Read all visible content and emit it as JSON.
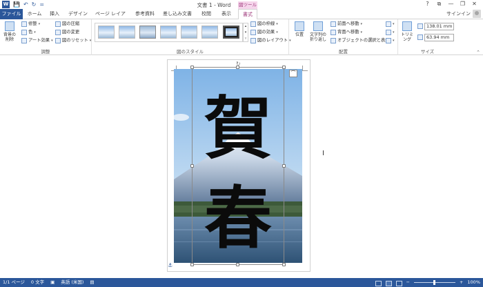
{
  "window": {
    "title": "文書 1 - Word",
    "help": "?",
    "minimize": "—",
    "restore": "❐",
    "close": "✕",
    "ribbon_display": "⧉"
  },
  "qat": {
    "save": "💾",
    "undo": "↶",
    "redo": "↻",
    "customize": "="
  },
  "context_header": "図ツール",
  "tabs": [
    {
      "label": "ファイル"
    },
    {
      "label": "ホーム"
    },
    {
      "label": "挿入"
    },
    {
      "label": "デザイン"
    },
    {
      "label": "ページ レイアウト"
    },
    {
      "label": "参考資料"
    },
    {
      "label": "差し込み文書"
    },
    {
      "label": "校閲"
    },
    {
      "label": "表示"
    },
    {
      "label": "書式"
    }
  ],
  "signin": "サインイン",
  "ribbon": {
    "adjust": {
      "label": "調整",
      "remove_bg": "背景の\n削除",
      "corrections": "修整",
      "color": "色",
      "artistic": "アート効果",
      "compress": "図の圧縮",
      "change": "図の変更",
      "reset": "図のリセット"
    },
    "styles": {
      "label": "図のスタイル",
      "border": "図の枠線",
      "effects": "図の効果",
      "layout": "図のレイアウト"
    },
    "arrange": {
      "label": "配置",
      "position": "位置",
      "wrap": "文字列の\n折り返し",
      "forward": "前面へ移動",
      "backward": "背面へ移動",
      "selection_pane": "オブジェクトの選択と表示"
    },
    "size": {
      "label": "サイズ",
      "crop": "トリミング",
      "height": "138.01 mm",
      "width": "63.94 mm"
    }
  },
  "statusbar": {
    "page": "1/1 ページ",
    "words": "0 文字",
    "language": "英語 (米国)",
    "zoom": "100%",
    "minus": "−",
    "plus": "+"
  },
  "photo_text": "賀春"
}
